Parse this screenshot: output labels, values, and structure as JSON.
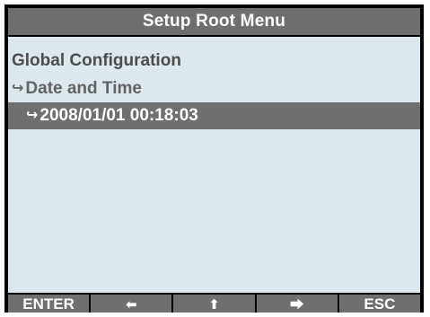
{
  "title": "Setup Root Menu",
  "menu": {
    "heading": "Global Configuration",
    "submenu_label": "Date and Time",
    "selected_value": "2008/01/01 00:18:03",
    "indent_arrow": "↪"
  },
  "softkeys": [
    {
      "label": "ENTER",
      "icon": ""
    },
    {
      "label": "",
      "icon": "left-arrow-icon",
      "glyph": "🡸"
    },
    {
      "label": "",
      "icon": "up-arrow-icon",
      "glyph": "🡹"
    },
    {
      "label": "",
      "icon": "right-arrow-icon",
      "glyph": "🡺"
    },
    {
      "label": "ESC",
      "icon": ""
    }
  ],
  "colors": {
    "frame": "#000000",
    "title_bar": "#6f6f6f",
    "content_bg": "#dce8ee",
    "highlight": "#6f6f6f",
    "text": "#4d4d4d"
  }
}
